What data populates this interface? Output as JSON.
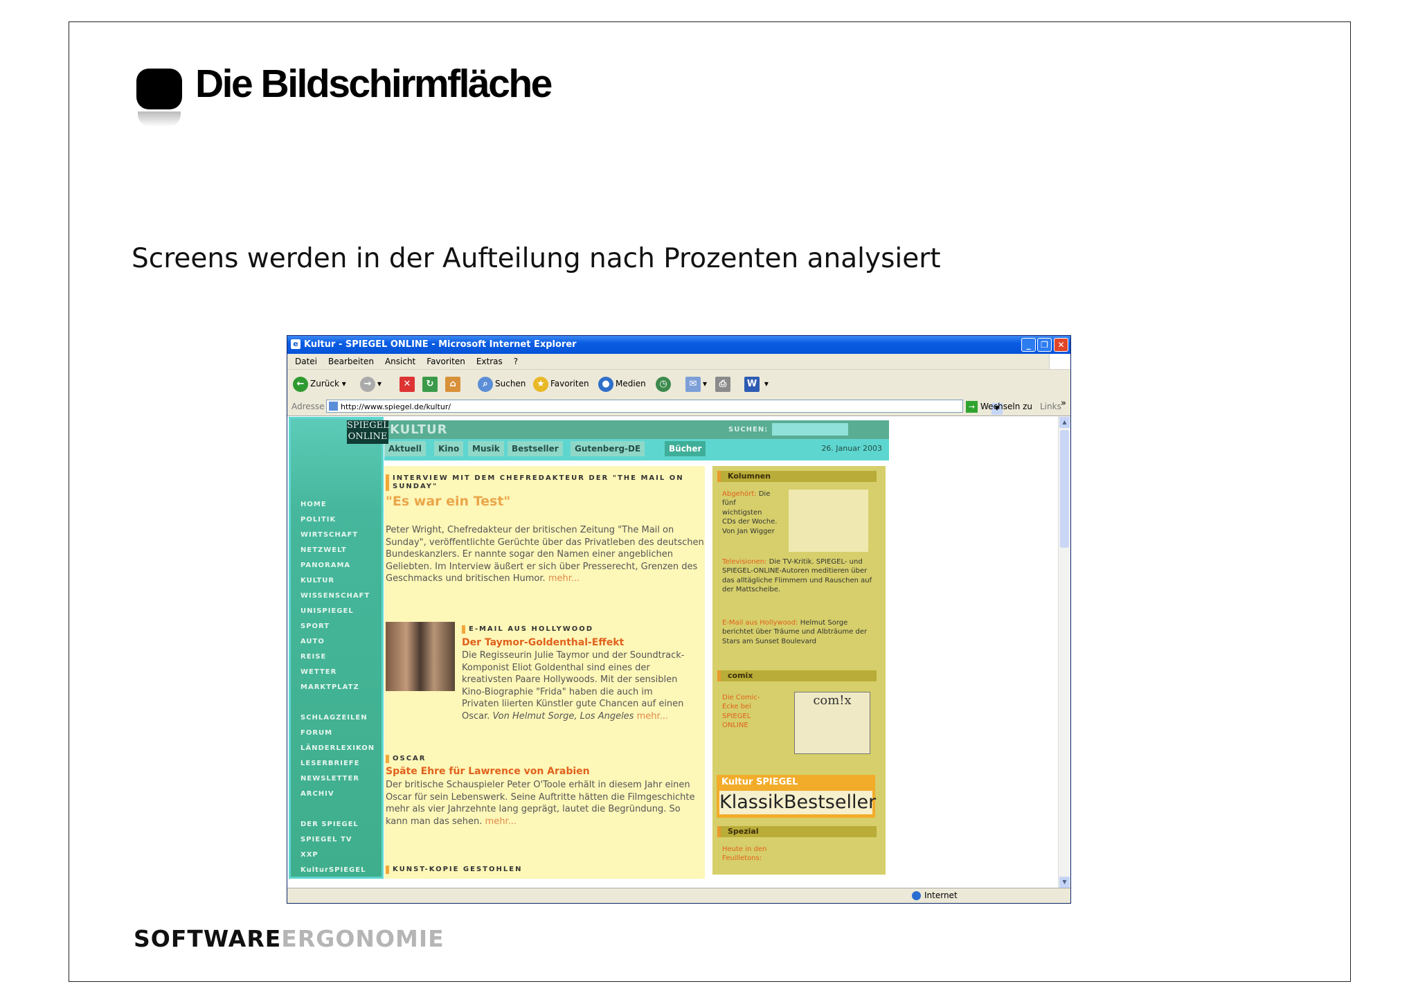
{
  "slide": {
    "title": "Die Bildschirmfläche",
    "subtitle": "Screens werden in der Aufteilung nach Prozenten analysiert",
    "footer_bold": "SOFTWARE",
    "footer_light": "ERGONOMIE"
  },
  "browser": {
    "title": "Kultur - SPIEGEL ONLINE - Microsoft Internet Explorer",
    "menu": [
      "Datei",
      "Bearbeiten",
      "Ansicht",
      "Favoriten",
      "Extras",
      "?"
    ],
    "toolbar": {
      "back": "Zurück",
      "search": "Suchen",
      "favorites": "Favoriten",
      "media": "Medien"
    },
    "address_label": "Adresse",
    "url": "http://www.spiegel.de/kultur/",
    "go": "Wechseln zu",
    "links": "Links",
    "status_zone": "Internet"
  },
  "page": {
    "logo_line1": "SPIEGEL",
    "logo_line2": "ONLINE",
    "section": "KULTUR",
    "search_label": "SUCHEN:",
    "tabs": [
      "Aktuell",
      "Kino",
      "Musik",
      "Bestseller",
      "Gutenberg-DE",
      "Bücher"
    ],
    "date": "26. Januar 2003",
    "nav": [
      "HOME",
      "POLITIK",
      "WIRTSCHAFT",
      "NETZWELT",
      "PANORAMA",
      "KULTUR",
      "WISSENSCHAFT",
      "UNISPIEGEL",
      "SPORT",
      "AUTO",
      "REISE",
      "WETTER",
      "MARKTPLATZ"
    ],
    "nav2": [
      "SCHLAGZEILEN",
      "FORUM",
      "LÄNDERLEXIKON",
      "LESERBRIEFE",
      "NEWSLETTER",
      "ARCHIV"
    ],
    "nav3": [
      "DER SPIEGEL",
      "SPIEGEL TV",
      "XXP",
      "KulturSPIEGEL"
    ],
    "article1": {
      "kicker": "INTERVIEW MIT DEM CHEFREDAKTEUR DER \"THE MAIL ON SUNDAY\"",
      "headline": "\"Es war ein Test\"",
      "body": "Peter Wright, Chefredakteur der britischen Zeitung \"The Mail on Sunday\", veröffentlichte Gerüchte über das Privatleben des deutschen Bundeskanzlers. Er nannte sogar den Namen einer angeblichen Geliebten. Im Interview äußert er sich über Presserecht, Grenzen des Geschmacks und britischen Humor.",
      "more": "mehr..."
    },
    "article2": {
      "kicker": "E-MAIL AUS HOLLYWOOD",
      "headline": "Der Taymor-Goldenthal-Effekt",
      "body": "Die Regisseurin Julie Taymor und der Soundtrack-Komponist Eliot Goldenthal sind eines der kreativsten Paare Hollywoods. Mit der sensiblen Kino-Biographie \"Frida\" haben die auch im Privaten liierten Künstler gute Chancen auf einen Oscar.",
      "byline": "Von Helmut Sorge, Los Angeles",
      "more": "mehr..."
    },
    "article3": {
      "kicker": "OSCAR",
      "headline": "Späte Ehre für Lawrence von Arabien",
      "body": "Der britische Schauspieler Peter O'Toole erhält in diesem Jahr einen Oscar für sein Lebenswerk. Seine Auftritte hätten die Filmgeschichte mehr als vier Jahrzehnte lang geprägt, lautet die Begründung. So kann man das sehen.",
      "more": "mehr..."
    },
    "article4_kicker": "KUNST-KOPIE GESTOHLEN",
    "sidebar": {
      "kolumnen": "Kolumnen",
      "item1_title": "Abgehört:",
      "item1_text": "Die fünf wichtigsten CDs der Woche. Von Jan Wigger",
      "item2_title": "Televisionen:",
      "item2_text": "Die TV-Kritik. SPIEGEL- und SPIEGEL-ONLINE-Autoren meditieren über das alltägliche Flimmern und Rauschen auf der Mattscheibe.",
      "item3_title": "E-Mail aus Hollywood:",
      "item3_text": "Helmut Sorge berichtet über Träume und Albträume der Stars am Sunset Boulevard",
      "comix_head": "comix",
      "comix_text": "Die Comic-Ecke bei SPIEGEL ONLINE",
      "comix_logo": "com!x",
      "kultur_spiegel": "Kultur SPIEGEL",
      "klassik": "KlassikBestseller",
      "spezial": "Spezial",
      "spezial_text": "Heute in den Feuilletons:"
    }
  }
}
